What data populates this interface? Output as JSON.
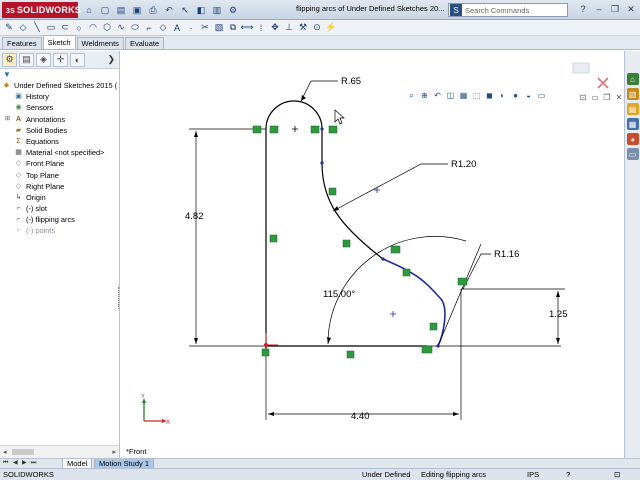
{
  "app": {
    "brand": "SOLIDWORKS",
    "window_title": "flipping arcs of Under Defined Sketches 20...",
    "search_placeholder": "Search Commands"
  },
  "tabs": [
    {
      "label": "Features",
      "active": false
    },
    {
      "label": "Sketch",
      "active": true
    },
    {
      "label": "Weldments",
      "active": false
    },
    {
      "label": "Evaluate",
      "active": false
    }
  ],
  "tree": {
    "root": "Under Defined Sketches 2015  (",
    "items": [
      {
        "label": "History",
        "icon": "history-icon"
      },
      {
        "label": "Sensors",
        "icon": "sensors-icon"
      },
      {
        "label": "Annotations",
        "icon": "annotations-icon"
      },
      {
        "label": "Solid Bodies",
        "icon": "solid-bodies-icon"
      },
      {
        "label": "Equations",
        "icon": "equations-icon"
      },
      {
        "label": "Material <not specified>",
        "icon": "material-icon"
      },
      {
        "label": "Front Plane",
        "icon": "plane-icon"
      },
      {
        "label": "Top Plane",
        "icon": "plane-icon"
      },
      {
        "label": "Right Plane",
        "icon": "plane-icon"
      },
      {
        "label": "Origin",
        "icon": "origin-icon"
      },
      {
        "label": "(-) slot",
        "icon": "sketch-icon"
      },
      {
        "label": "(-) flipping arcs",
        "icon": "sketch-icon"
      },
      {
        "label": "(-) points",
        "icon": "sketch-icon"
      }
    ]
  },
  "sketch": {
    "dimensions": {
      "top_radius": "R.65",
      "height": "4.82",
      "middle_radius": "R1.20",
      "right_radius": "R1.16",
      "angle": "115.00°",
      "vertical_right": "1.25",
      "width": "4.40"
    },
    "view_label": "*Front",
    "triad_x": "X",
    "triad_y": "Y"
  },
  "bottom_tabs": [
    {
      "label": "Model",
      "active": true
    },
    {
      "label": "Motion Study 1",
      "active": false
    }
  ],
  "status": {
    "app": "SOLIDWORKS",
    "state": "Under Defined",
    "editing": "Editing flipping arcs",
    "units": "IPS"
  },
  "colors": {
    "sketch_line": "#000000",
    "selected_arc": "#1e2aa0",
    "relation_badge": "#2e9a3e",
    "brand_red": "#b4132a"
  }
}
